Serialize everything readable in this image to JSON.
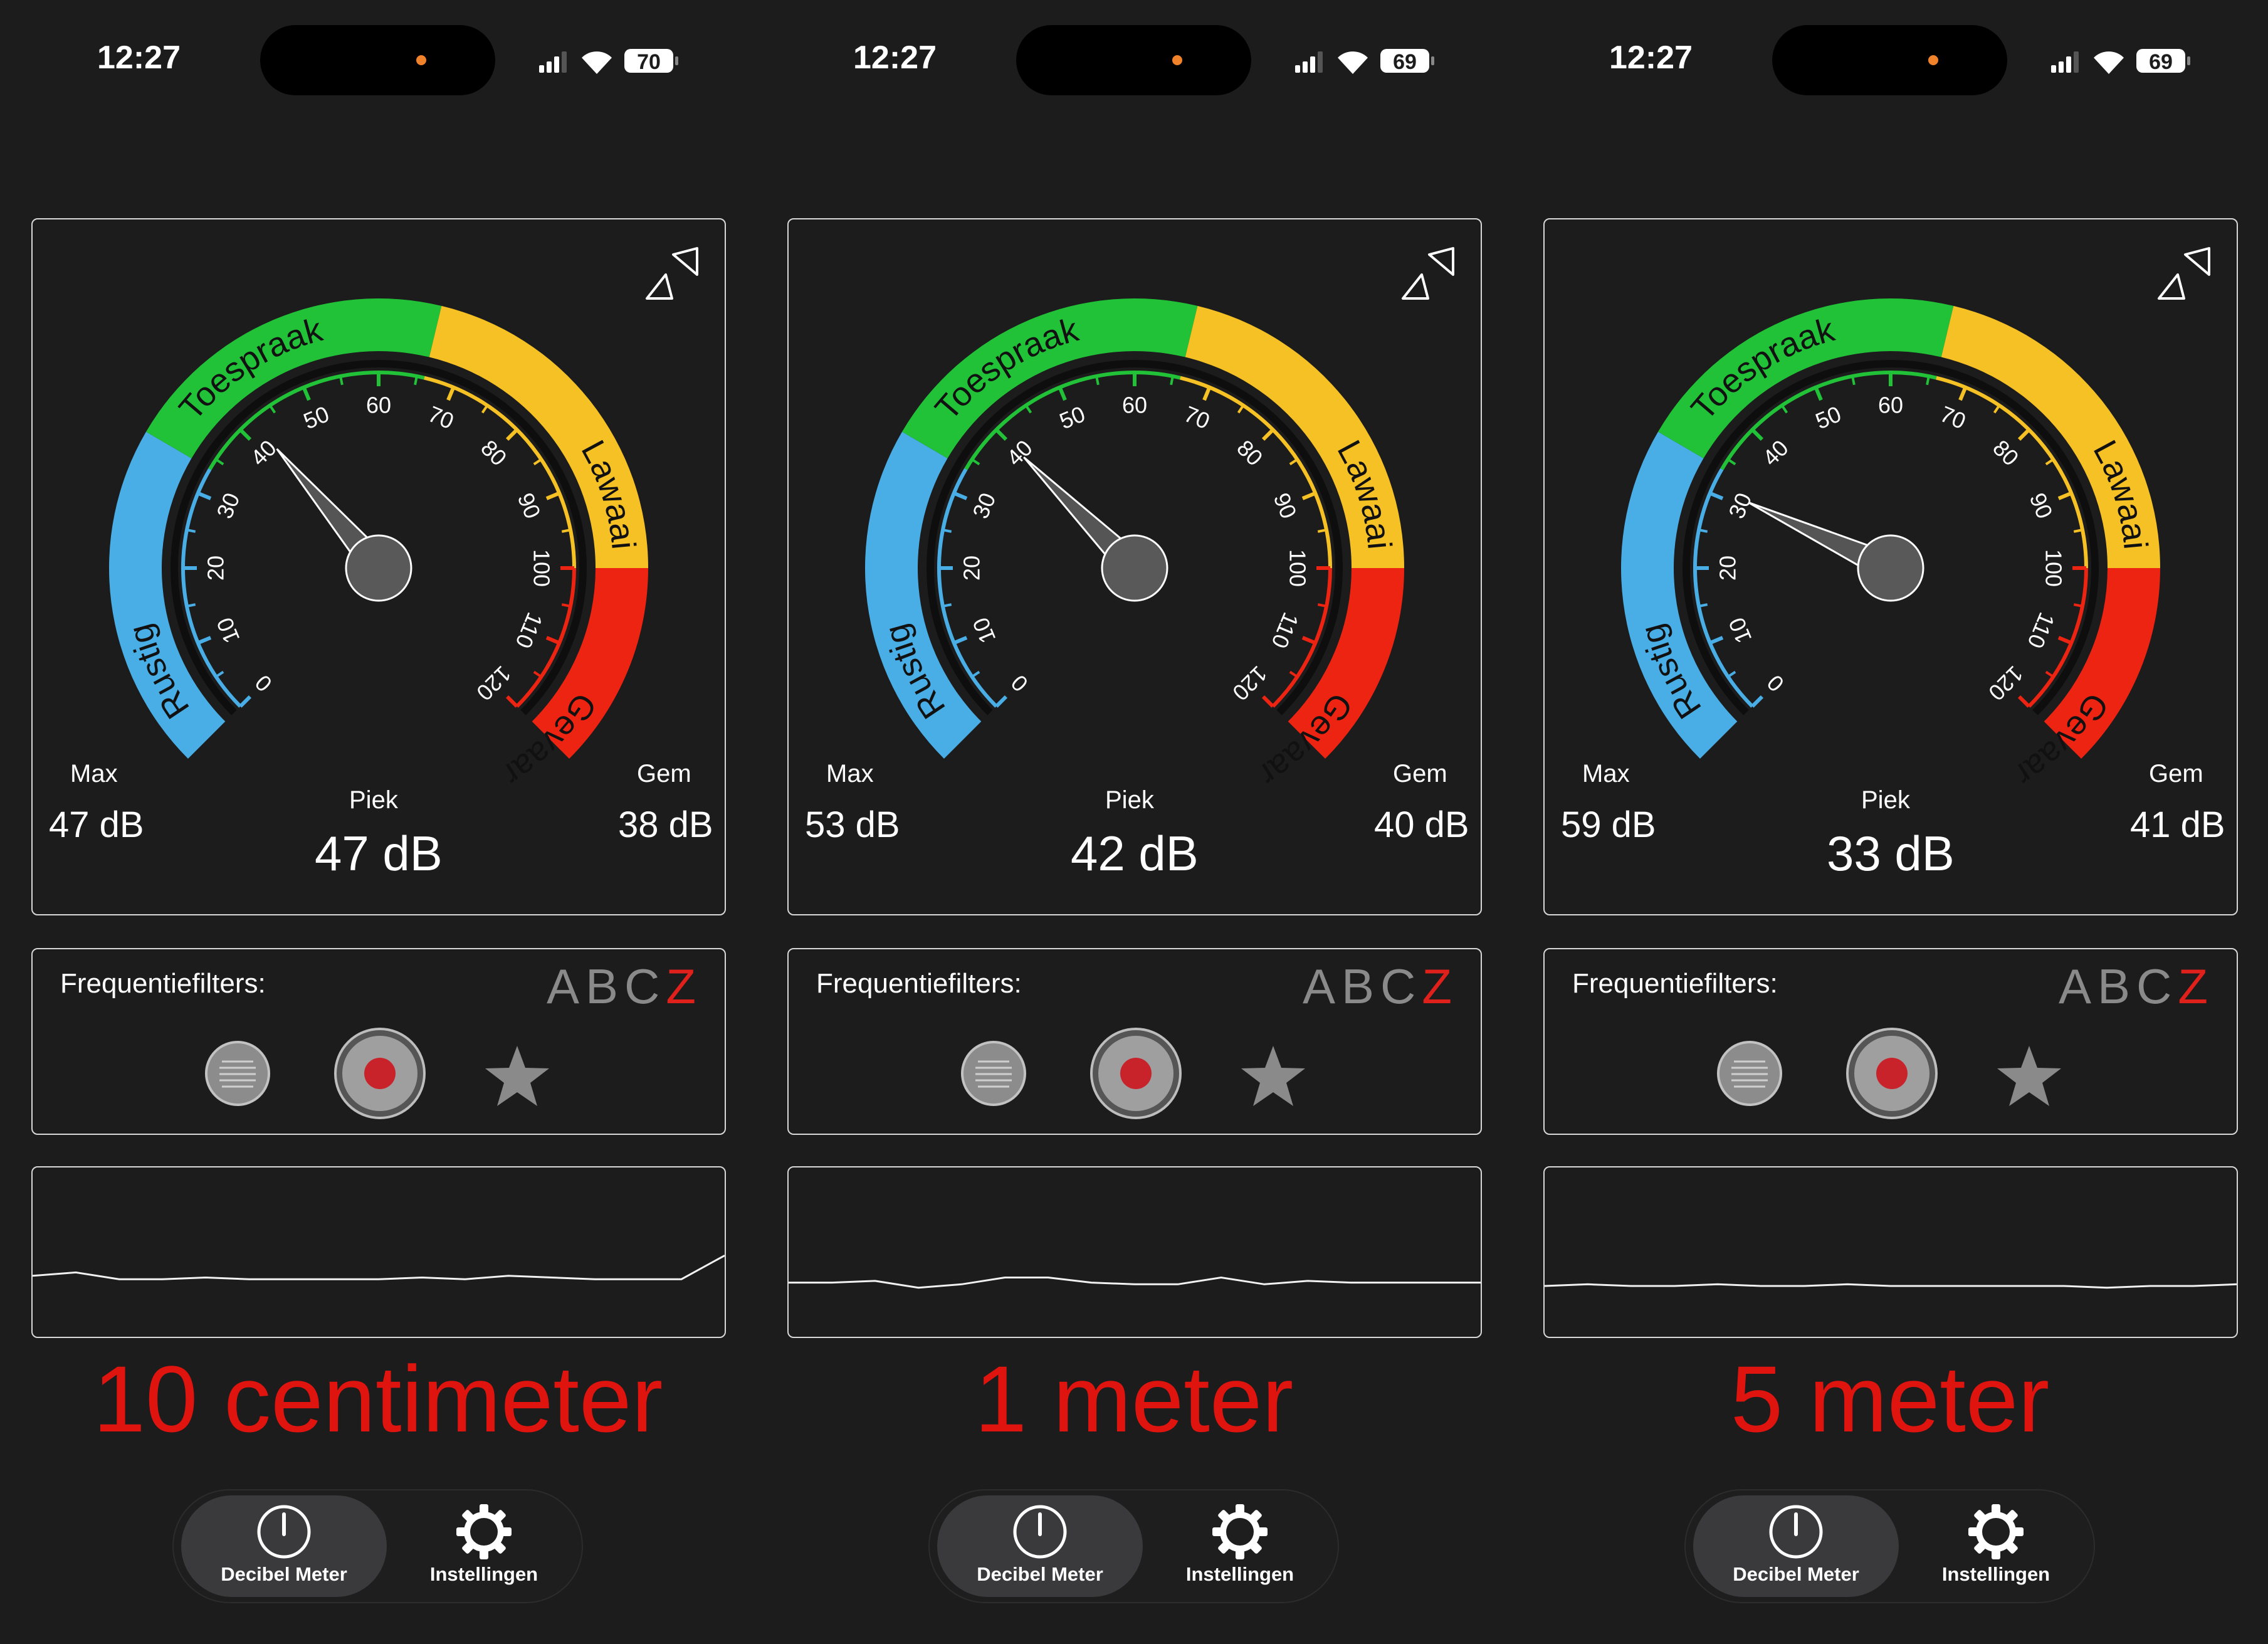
{
  "common": {
    "zones": {
      "quiet": "Rustig",
      "speech": "Toespraak",
      "noise": "Lawaai",
      "danger": "Gevaar"
    },
    "scale_ticks": [
      "0",
      "10",
      "20",
      "30",
      "40",
      "50",
      "60",
      "70",
      "80",
      "90",
      "100",
      "110",
      "120"
    ],
    "labels": {
      "max": "Max",
      "peak": "Piek",
      "avg": "Gem"
    },
    "filters_title": "Frequentiefilters:",
    "filter_letters": [
      "A",
      "B",
      "C",
      "Z"
    ],
    "active_filter": "Z",
    "tabs": {
      "meter": "Decibel Meter",
      "settings": "Instellingen"
    },
    "colors": {
      "quiet": "#4aaee6",
      "speech": "#22c238",
      "noise": "#f6c124",
      "danger": "#ee2412",
      "accent_red": "#e0140e",
      "record": "#c8232b"
    }
  },
  "panels": [
    {
      "time": "12:27",
      "battery": "70",
      "max": "47 dB",
      "peak": "47 dB",
      "avg": "38 dB",
      "needle_db": 42,
      "waveform": [
        0.64,
        0.62,
        0.66,
        0.66,
        0.65,
        0.66,
        0.66,
        0.66,
        0.66,
        0.65,
        0.66,
        0.64,
        0.65,
        0.66,
        0.66,
        0.66,
        0.52
      ],
      "distance": "10 centimeter"
    },
    {
      "time": "12:27",
      "battery": "69",
      "max": "53 dB",
      "peak": "42 dB",
      "avg": "40 dB",
      "needle_db": 40,
      "waveform": [
        0.68,
        0.68,
        0.67,
        0.71,
        0.69,
        0.65,
        0.65,
        0.68,
        0.69,
        0.69,
        0.65,
        0.69,
        0.67,
        0.68,
        0.68,
        0.68,
        0.68
      ],
      "distance": "1 meter"
    },
    {
      "time": "12:27",
      "battery": "69",
      "max": "59 dB",
      "peak": "33 dB",
      "avg": "41 dB",
      "needle_db": 31,
      "waveform": [
        0.7,
        0.69,
        0.7,
        0.7,
        0.69,
        0.7,
        0.7,
        0.69,
        0.7,
        0.7,
        0.7,
        0.7,
        0.7,
        0.71,
        0.7,
        0.7,
        0.69
      ],
      "distance": "5 meter"
    }
  ]
}
